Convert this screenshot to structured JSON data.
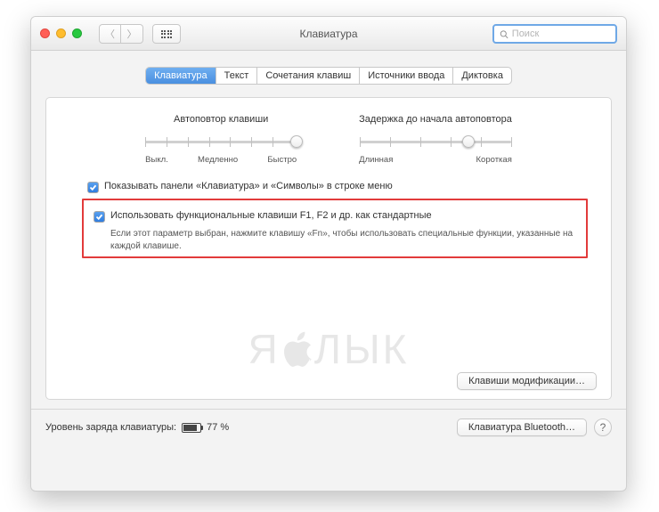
{
  "window": {
    "title": "Клавиатура"
  },
  "search": {
    "placeholder": "Поиск"
  },
  "tabs": [
    {
      "label": "Клавиатура",
      "active": true
    },
    {
      "label": "Текст"
    },
    {
      "label": "Сочетания клавиш"
    },
    {
      "label": "Источники ввода"
    },
    {
      "label": "Диктовка"
    }
  ],
  "sliders": {
    "repeat": {
      "title": "Автоповтор клавиши",
      "value": 1.0,
      "labels": {
        "off": "Выкл.",
        "slow": "Медленно",
        "fast": "Быстро"
      }
    },
    "delay": {
      "title": "Задержка до начала автоповтора",
      "value": 0.72,
      "labels": {
        "long": "Длинная",
        "short": "Короткая"
      }
    }
  },
  "checks": {
    "show_panels": {
      "checked": true,
      "label": "Показывать панели «Клавиатура» и «Символы» в строке меню"
    },
    "fn_keys": {
      "checked": true,
      "label": "Использовать функциональные клавиши F1, F2 и др. как стандартные",
      "desc": "Если этот параметр выбран, нажмите клавишу «Fn», чтобы использовать специальные функции, указанные на каждой клавише."
    }
  },
  "buttons": {
    "modifiers": "Клавиши модификации…",
    "bluetooth": "Клавиатура Bluetooth…"
  },
  "footer": {
    "battery_label": "Уровень заряда клавиатуры:",
    "battery_pct_text": "77 %",
    "battery_pct": 77
  },
  "watermark": {
    "left": "Я",
    "right": "ЛЫК"
  }
}
